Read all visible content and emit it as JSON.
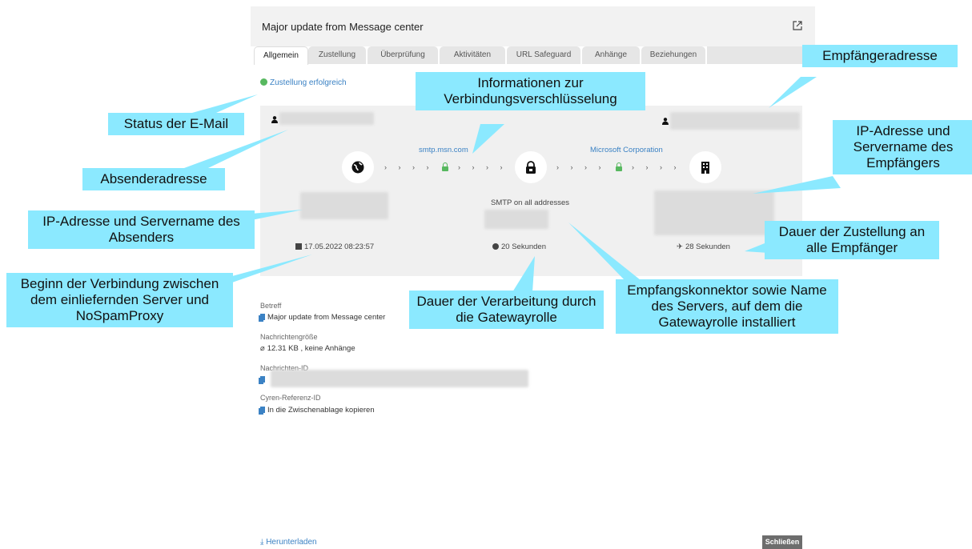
{
  "dialog": {
    "title": "Major update from Message center",
    "tabs": [
      "Allgemein",
      "Zustellung",
      "Überprüfung",
      "Aktivitäten",
      "URL Safeguard",
      "Anhänge",
      "Beziehungen"
    ]
  },
  "status": "Zustellung erfolgreich",
  "flow": {
    "sender_host": "smtp.msn.com",
    "recipient_org": "Microsoft Corporation",
    "connector": "SMTP on all addresses",
    "start": "17.05.2022 08:23:57",
    "processing": "20 Sekunden",
    "delivery": "28 Sekunden"
  },
  "details": {
    "subject_label": "Betreff",
    "subject": "Major update from Message center",
    "size_label": "Nachrichtengröße",
    "size": "12.31 KB , keine Anhänge",
    "id_label": "Nachrichten-ID",
    "cyren_label": "Cyren-Referenz-ID",
    "cyren_value": "In die Zwischenablage kopieren"
  },
  "footer": {
    "download": "Herunterladen",
    "close": "Schließen"
  },
  "callouts": {
    "status": "Status der E-Mail",
    "sender": "Absenderadresse",
    "sender_ip": "IP-Adresse und Servername des Absenders",
    "start": "Beginn der Verbindung zwischen dem einliefernden Server und NoSpamProxy",
    "encryption": "Informationen zur Verbindungsverschlüsselung",
    "processing": "Dauer der Verarbeitung durch die Gatewayrolle",
    "connector": "Empfangskonnektor sowie Name des Servers, auf dem die Gatewayrolle installiert",
    "recipient": "Empfängeradresse",
    "recipient_ip": "IP-Adresse und Servername des Empfängers",
    "delivery": "Dauer der Zustellung an alle Empfänger"
  },
  "colors": {
    "callout": "#8be9ff",
    "link": "#3b82c4",
    "lock": "#57b85f",
    "panel": "#f0f0f0"
  }
}
